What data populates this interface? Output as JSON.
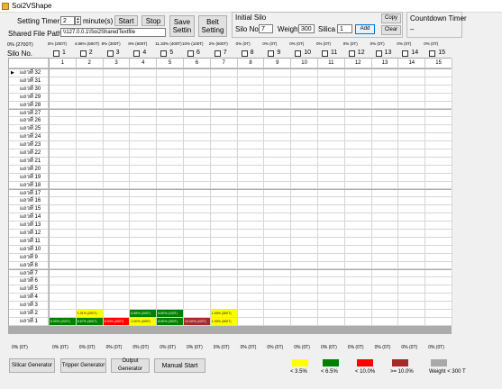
{
  "window": {
    "title": "Soi2VShape"
  },
  "header": {
    "setting_timer_label": "Setting Timer",
    "timer_value": "2",
    "minute_label": "minute(s)",
    "start_label": "Start",
    "stop_label": "Stop",
    "save_label": "Save Settin",
    "belt_label": "Belt Setting",
    "shared_path_label": "Shared File Path",
    "shared_path_value": "\\\\127.0.0.1\\Soi2SharedTextfile"
  },
  "initial_silo": {
    "title": "Initial Silo",
    "silo_no_label": "Silo No.",
    "silo_no_value": "7",
    "weight_label": "Weight",
    "weight_value": "300",
    "silica_label": "Silica",
    "silica_value": "1",
    "add_label": "Add",
    "copy_label": "Copy",
    "clear_label": "Clear"
  },
  "countdown": {
    "title": "Countdown Timer",
    "value": "–"
  },
  "top_stats": {
    "total": "0% (2700T)",
    "columns": [
      "5% (200T)",
      "4.66% (500T)",
      "8% (300T)",
      "8% (600T)",
      "11.33% (400T)",
      "10% (100T)",
      "2% (600T)",
      "0% (0T)",
      "0% (0T)",
      "0% (0T)",
      "0% (0T)",
      "0% (0T)",
      "0% (0T)",
      "0% (0T)",
      "0% (0T)"
    ]
  },
  "silo_row": {
    "label": "Silo No.",
    "numbers": [
      "1",
      "2",
      "3",
      "4",
      "5",
      "6",
      "7",
      "8",
      "9",
      "10",
      "11",
      "12",
      "13",
      "14",
      "15"
    ]
  },
  "grid": {
    "columns": [
      "1",
      "2",
      "3",
      "4",
      "5",
      "6",
      "7",
      "8",
      "9",
      "10",
      "11",
      "12",
      "13",
      "14",
      "15"
    ],
    "rows": [
      "แถวที่ 32",
      "แถวที่ 31",
      "แถวที่ 30",
      "แถวที่ 29",
      "แถวที่ 28",
      "แถวที่ 27",
      "แถวที่ 26",
      "แถวที่ 25",
      "แถวที่ 24",
      "แถวที่ 23",
      "แถวที่ 22",
      "แถวที่ 21",
      "แถวที่ 20",
      "แถวที่ 19",
      "แถวที่ 18",
      "แถวที่ 17",
      "แถวที่ 16",
      "แถวที่ 15",
      "แถวที่ 14",
      "แถวที่ 13",
      "แถวที่ 12",
      "แถวที่ 11",
      "แถวที่ 10",
      "แถวที่ 9",
      "แถวที่ 8",
      "แถวที่ 7",
      "แถวที่ 6",
      "แถวที่ 5",
      "แถวที่ 4",
      "แถวที่ 3",
      "แถวที่ 2",
      "แถวที่ 1"
    ],
    "current_row_marker": "▶",
    "filled_cells": [
      {
        "row": 30,
        "col": 1,
        "text": "1.01% (200T)",
        "color": "#ffff00"
      },
      {
        "row": 30,
        "col": 3,
        "text": "6.88% (300T)",
        "color": "#008000"
      },
      {
        "row": 30,
        "col": 4,
        "text": "5.00% (100T)",
        "color": "#008000"
      },
      {
        "row": 30,
        "col": 6,
        "text": "1.00% (300T)",
        "color": "#ffff00"
      },
      {
        "row": 31,
        "col": 0,
        "text": "5.00% (200T)",
        "color": "#008000"
      },
      {
        "row": 31,
        "col": 1,
        "text": "6.67% (300T)",
        "color": "#008000"
      },
      {
        "row": 31,
        "col": 2,
        "text": "8.00% (300T)",
        "color": "#ff0000"
      },
      {
        "row": 31,
        "col": 3,
        "text": "1.00% (300T)",
        "color": "#ffff00"
      },
      {
        "row": 31,
        "col": 4,
        "text": "8.00% (300T)",
        "color": "#008000"
      },
      {
        "row": 31,
        "col": 5,
        "text": "10.00% (100T)",
        "color": "#a52a2a"
      },
      {
        "row": 31,
        "col": 6,
        "text": "1.00% (300T)",
        "color": "#ffff00"
      }
    ]
  },
  "bottom_stats": {
    "total": "0% (0T)",
    "columns": [
      "0% (0T)",
      "0% (0T)",
      "0% (0T)",
      "0% (0T)",
      "0% (0T)",
      "0% (0T)",
      "0% (0T)",
      "0% (0T)",
      "0% (0T)",
      "0% (0T)",
      "0% (0T)",
      "0% (0T)",
      "0% (0T)",
      "0% (0T)",
      "0% (0T)"
    ]
  },
  "footer_buttons": {
    "silicar": "Silicar Generator",
    "tripper": "Tripper Generator",
    "output": "Output Generator",
    "manual": "Manual Start"
  },
  "legend": [
    {
      "label": "< 3.5%",
      "color": "#ffff00"
    },
    {
      "label": "< 6.5%",
      "color": "#008000"
    },
    {
      "label": "< 10.0%",
      "color": "#ff0000"
    },
    {
      "label": ">= 10.0%",
      "color": "#a52a2a"
    },
    {
      "label": "Weight < 300 T",
      "color": "#a9a9a9"
    }
  ]
}
